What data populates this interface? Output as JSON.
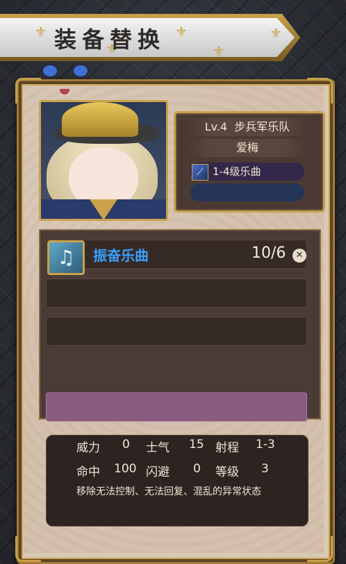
{
  "screen": {
    "title": "装备替换"
  },
  "character": {
    "level": "Lv.4",
    "unit_type": "步兵军乐队",
    "name": "爱梅",
    "weapon_label": "1-4级乐曲",
    "weapon_icon": "rifle-icon"
  },
  "equipment": {
    "selected": {
      "icon": "music-note-icon",
      "name": "振奋乐曲",
      "count": "10/6"
    }
  },
  "stats": {
    "power_label": "威力",
    "power_value": "0",
    "morale_label": "士气",
    "morale_value": "15",
    "range_label": "射程",
    "range_value": "1-3",
    "accuracy_label": "命中",
    "accuracy_value": "100",
    "evasion_label": "闪避",
    "evasion_value": "0",
    "grade_label": "等级",
    "grade_value": "3",
    "description": "移除无法控制、无法回复、混乱的异常状态"
  },
  "colors": {
    "gold_border": "#c9a24b",
    "equip_name": "#3aa0ff",
    "pink_slot": "#8a5a80"
  }
}
